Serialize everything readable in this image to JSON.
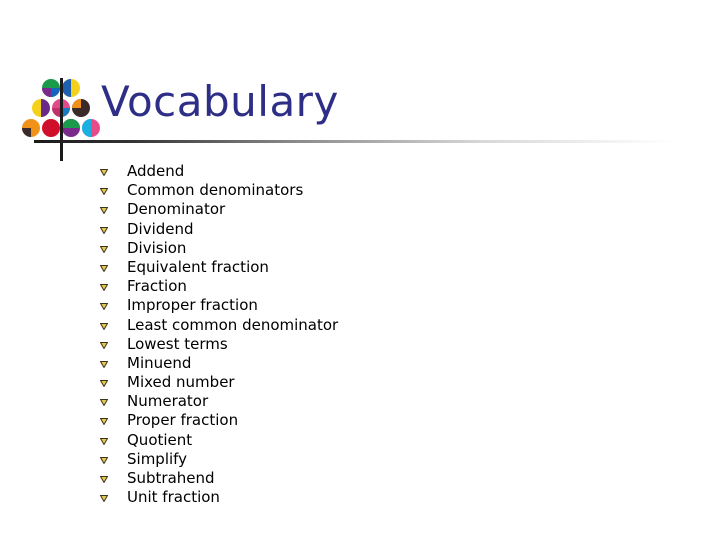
{
  "slide": {
    "title": "Vocabulary",
    "colors": {
      "title": "#2e2e86",
      "text": "#000000",
      "bullet_fill": "#e8c84a",
      "bullet_outline": "#3a3320"
    },
    "logo": {
      "icon": "colorful-fraction-circles-logo"
    },
    "bullet_icon": "triangle-down-bullet",
    "items": [
      "Addend",
      "Common denominators",
      "Denominator",
      "Dividend",
      "Division",
      "Equivalent fraction",
      "Fraction",
      "Improper fraction",
      "Least common denominator",
      "Lowest terms",
      "Minuend",
      "Mixed number",
      "Numerator",
      "Proper fraction",
      "Quotient",
      "Simplify",
      "Subtrahend",
      "Unit fraction"
    ]
  }
}
